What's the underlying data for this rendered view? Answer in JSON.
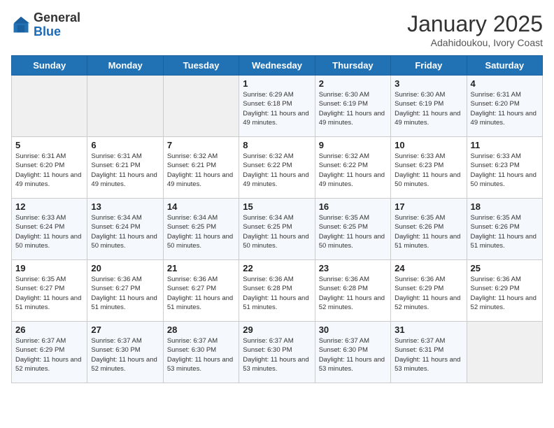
{
  "header": {
    "logo_general": "General",
    "logo_blue": "Blue",
    "month_title": "January 2025",
    "subtitle": "Adahidoukou, Ivory Coast"
  },
  "days_of_week": [
    "Sunday",
    "Monday",
    "Tuesday",
    "Wednesday",
    "Thursday",
    "Friday",
    "Saturday"
  ],
  "weeks": [
    [
      {
        "day": "",
        "sunrise": "",
        "sunset": "",
        "daylight": ""
      },
      {
        "day": "",
        "sunrise": "",
        "sunset": "",
        "daylight": ""
      },
      {
        "day": "",
        "sunrise": "",
        "sunset": "",
        "daylight": ""
      },
      {
        "day": "1",
        "sunrise": "Sunrise: 6:29 AM",
        "sunset": "Sunset: 6:18 PM",
        "daylight": "Daylight: 11 hours and 49 minutes."
      },
      {
        "day": "2",
        "sunrise": "Sunrise: 6:30 AM",
        "sunset": "Sunset: 6:19 PM",
        "daylight": "Daylight: 11 hours and 49 minutes."
      },
      {
        "day": "3",
        "sunrise": "Sunrise: 6:30 AM",
        "sunset": "Sunset: 6:19 PM",
        "daylight": "Daylight: 11 hours and 49 minutes."
      },
      {
        "day": "4",
        "sunrise": "Sunrise: 6:31 AM",
        "sunset": "Sunset: 6:20 PM",
        "daylight": "Daylight: 11 hours and 49 minutes."
      }
    ],
    [
      {
        "day": "5",
        "sunrise": "Sunrise: 6:31 AM",
        "sunset": "Sunset: 6:20 PM",
        "daylight": "Daylight: 11 hours and 49 minutes."
      },
      {
        "day": "6",
        "sunrise": "Sunrise: 6:31 AM",
        "sunset": "Sunset: 6:21 PM",
        "daylight": "Daylight: 11 hours and 49 minutes."
      },
      {
        "day": "7",
        "sunrise": "Sunrise: 6:32 AM",
        "sunset": "Sunset: 6:21 PM",
        "daylight": "Daylight: 11 hours and 49 minutes."
      },
      {
        "day": "8",
        "sunrise": "Sunrise: 6:32 AM",
        "sunset": "Sunset: 6:22 PM",
        "daylight": "Daylight: 11 hours and 49 minutes."
      },
      {
        "day": "9",
        "sunrise": "Sunrise: 6:32 AM",
        "sunset": "Sunset: 6:22 PM",
        "daylight": "Daylight: 11 hours and 49 minutes."
      },
      {
        "day": "10",
        "sunrise": "Sunrise: 6:33 AM",
        "sunset": "Sunset: 6:23 PM",
        "daylight": "Daylight: 11 hours and 50 minutes."
      },
      {
        "day": "11",
        "sunrise": "Sunrise: 6:33 AM",
        "sunset": "Sunset: 6:23 PM",
        "daylight": "Daylight: 11 hours and 50 minutes."
      }
    ],
    [
      {
        "day": "12",
        "sunrise": "Sunrise: 6:33 AM",
        "sunset": "Sunset: 6:24 PM",
        "daylight": "Daylight: 11 hours and 50 minutes."
      },
      {
        "day": "13",
        "sunrise": "Sunrise: 6:34 AM",
        "sunset": "Sunset: 6:24 PM",
        "daylight": "Daylight: 11 hours and 50 minutes."
      },
      {
        "day": "14",
        "sunrise": "Sunrise: 6:34 AM",
        "sunset": "Sunset: 6:25 PM",
        "daylight": "Daylight: 11 hours and 50 minutes."
      },
      {
        "day": "15",
        "sunrise": "Sunrise: 6:34 AM",
        "sunset": "Sunset: 6:25 PM",
        "daylight": "Daylight: 11 hours and 50 minutes."
      },
      {
        "day": "16",
        "sunrise": "Sunrise: 6:35 AM",
        "sunset": "Sunset: 6:25 PM",
        "daylight": "Daylight: 11 hours and 50 minutes."
      },
      {
        "day": "17",
        "sunrise": "Sunrise: 6:35 AM",
        "sunset": "Sunset: 6:26 PM",
        "daylight": "Daylight: 11 hours and 51 minutes."
      },
      {
        "day": "18",
        "sunrise": "Sunrise: 6:35 AM",
        "sunset": "Sunset: 6:26 PM",
        "daylight": "Daylight: 11 hours and 51 minutes."
      }
    ],
    [
      {
        "day": "19",
        "sunrise": "Sunrise: 6:35 AM",
        "sunset": "Sunset: 6:27 PM",
        "daylight": "Daylight: 11 hours and 51 minutes."
      },
      {
        "day": "20",
        "sunrise": "Sunrise: 6:36 AM",
        "sunset": "Sunset: 6:27 PM",
        "daylight": "Daylight: 11 hours and 51 minutes."
      },
      {
        "day": "21",
        "sunrise": "Sunrise: 6:36 AM",
        "sunset": "Sunset: 6:27 PM",
        "daylight": "Daylight: 11 hours and 51 minutes."
      },
      {
        "day": "22",
        "sunrise": "Sunrise: 6:36 AM",
        "sunset": "Sunset: 6:28 PM",
        "daylight": "Daylight: 11 hours and 51 minutes."
      },
      {
        "day": "23",
        "sunrise": "Sunrise: 6:36 AM",
        "sunset": "Sunset: 6:28 PM",
        "daylight": "Daylight: 11 hours and 52 minutes."
      },
      {
        "day": "24",
        "sunrise": "Sunrise: 6:36 AM",
        "sunset": "Sunset: 6:29 PM",
        "daylight": "Daylight: 11 hours and 52 minutes."
      },
      {
        "day": "25",
        "sunrise": "Sunrise: 6:36 AM",
        "sunset": "Sunset: 6:29 PM",
        "daylight": "Daylight: 11 hours and 52 minutes."
      }
    ],
    [
      {
        "day": "26",
        "sunrise": "Sunrise: 6:37 AM",
        "sunset": "Sunset: 6:29 PM",
        "daylight": "Daylight: 11 hours and 52 minutes."
      },
      {
        "day": "27",
        "sunrise": "Sunrise: 6:37 AM",
        "sunset": "Sunset: 6:30 PM",
        "daylight": "Daylight: 11 hours and 52 minutes."
      },
      {
        "day": "28",
        "sunrise": "Sunrise: 6:37 AM",
        "sunset": "Sunset: 6:30 PM",
        "daylight": "Daylight: 11 hours and 53 minutes."
      },
      {
        "day": "29",
        "sunrise": "Sunrise: 6:37 AM",
        "sunset": "Sunset: 6:30 PM",
        "daylight": "Daylight: 11 hours and 53 minutes."
      },
      {
        "day": "30",
        "sunrise": "Sunrise: 6:37 AM",
        "sunset": "Sunset: 6:30 PM",
        "daylight": "Daylight: 11 hours and 53 minutes."
      },
      {
        "day": "31",
        "sunrise": "Sunrise: 6:37 AM",
        "sunset": "Sunset: 6:31 PM",
        "daylight": "Daylight: 11 hours and 53 minutes."
      },
      {
        "day": "",
        "sunrise": "",
        "sunset": "",
        "daylight": ""
      }
    ]
  ]
}
